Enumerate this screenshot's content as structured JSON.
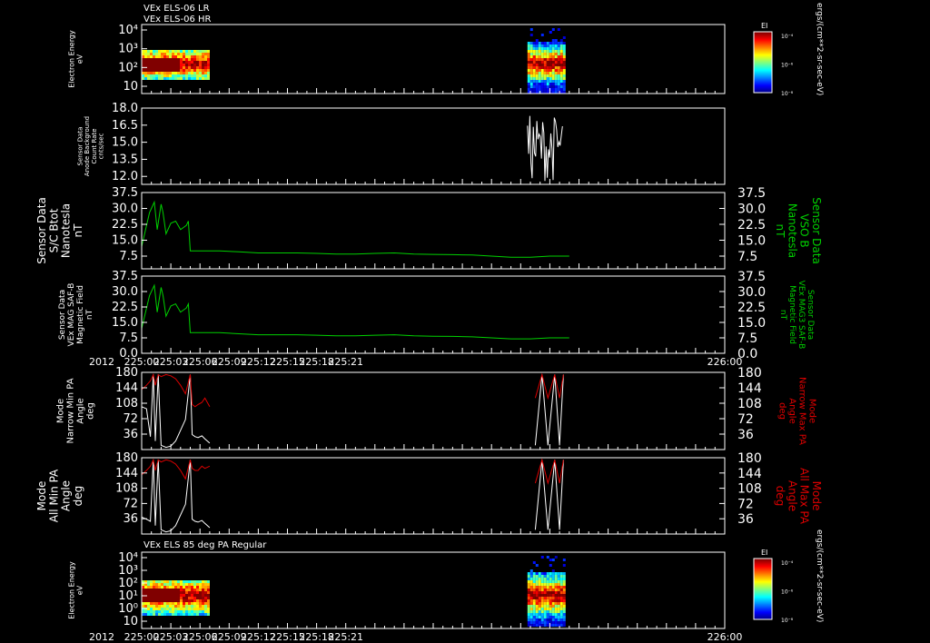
{
  "header_lines": [
    "VEx ELS-06 LR",
    "VEx ELS-06 HR"
  ],
  "year_label": "2012",
  "colors": {
    "white": "#ffffff",
    "green": "#00d000",
    "red": "#dd0000"
  },
  "colorbars": [
    {
      "title": "EI",
      "ticks": [
        "10⁻⁴",
        "10⁻⁶",
        "10⁻⁸"
      ],
      "unit": "ergs/(cm**2-sr-sec-eV)"
    },
    {
      "title": "EI",
      "ticks": [
        "10⁻⁴",
        "10⁻⁶",
        "10⁻⁸"
      ],
      "unit": "ergs/(cm**2-sr-sec-eV)"
    }
  ],
  "panel7_title": "VEx ELS 85 deg PA Regular",
  "chart_data": [
    {
      "type": "heatmap",
      "ylabel": [
        "Electron Energy",
        "eV"
      ],
      "yscale": "log",
      "yticks": [
        "10⁴",
        "10³",
        "10²",
        "10"
      ],
      "x_range": [
        "225:00",
        "226:00"
      ],
      "data_intervals_min": [
        [
          0.0,
          7.0
        ],
        [
          39.7,
          43.4
        ]
      ]
    },
    {
      "type": "line",
      "ylabel": [
        "Sensor Data",
        "Anode Background",
        "Count Rate",
        "cnts/sec"
      ],
      "yticks": [
        "18.0",
        "16.5",
        "15.0",
        "13.5",
        "12.0"
      ],
      "ylim": [
        11.3,
        18.0
      ],
      "series": [
        {
          "color": "white",
          "x_min_range": [
            39.7,
            43.4
          ],
          "y_range": [
            11.6,
            17.4
          ]
        }
      ]
    },
    {
      "type": "line",
      "ylabel": [
        "Sensor Data",
        "S/C Btot",
        "Nanotesla",
        "nT"
      ],
      "ylabel_right": [
        "Sensor Data",
        "VSO B",
        "Nanotesla",
        "nT"
      ],
      "yticks": [
        "37.5",
        "30.0",
        "22.5",
        "15.0",
        "7.5"
      ],
      "ylim": [
        1.5,
        37.5
      ],
      "series": [
        {
          "color": "green",
          "x": [
            0,
            0.8,
            1.3,
            1.6,
            2.0,
            2.2,
            2.5,
            3.0,
            3.5,
            4.0,
            4.3,
            4.6,
            4.8,
            5.0,
            6,
            8,
            10,
            12,
            14,
            16,
            18,
            20,
            22,
            24,
            26,
            28,
            30,
            32,
            34,
            36,
            38,
            40,
            42,
            44
          ],
          "y": [
            12,
            28,
            33,
            20,
            32,
            28,
            18,
            23,
            24,
            20,
            21,
            22,
            24,
            10,
            10,
            10,
            9.5,
            9,
            9,
            9,
            8.8,
            8.5,
            8.5,
            8.8,
            9,
            8.5,
            8.3,
            8.2,
            8,
            7.5,
            7,
            7,
            7.5,
            7.5
          ]
        }
      ]
    },
    {
      "type": "line",
      "ylabel": [
        "Sensor Data",
        "VEx MAG SAF-B",
        "Magnetic Field",
        "nT"
      ],
      "ylabel_right": [
        "Sensor Data",
        "VEx MAG3 SAF-B",
        "Magnetic Field",
        "nT"
      ],
      "yticks": [
        "37.5",
        "30.0",
        "22.5",
        "15.0",
        "7.5",
        "0.0"
      ],
      "ylim": [
        0,
        37.5
      ],
      "series": [
        {
          "color": "green",
          "x": [
            0,
            0.8,
            1.3,
            1.6,
            2.0,
            2.2,
            2.5,
            3.0,
            3.5,
            4.0,
            4.3,
            4.6,
            4.8,
            5.0,
            6,
            8,
            10,
            12,
            14,
            16,
            18,
            20,
            22,
            24,
            26,
            28,
            30,
            32,
            34,
            36,
            38,
            40,
            42,
            44
          ],
          "y": [
            12,
            28,
            33,
            20,
            32,
            28,
            18,
            23,
            24,
            20,
            21,
            22,
            24,
            10,
            10,
            10,
            9.5,
            9,
            9,
            9,
            8.8,
            8.5,
            8.5,
            8.8,
            9,
            8.5,
            8.3,
            8.2,
            8,
            7.5,
            7,
            7,
            7.5,
            7.5
          ]
        }
      ],
      "xtick_labels": [
        "225:00",
        "225:03",
        "225:06",
        "225:09",
        "225:12",
        "225:15",
        "225:18",
        "225:21",
        "226:00"
      ]
    },
    {
      "type": "line",
      "ylabel": [
        "Mode",
        "Narrow Min PA",
        "Angle",
        "deg"
      ],
      "ylabel_right": [
        "Mode",
        "Narrow Max PA",
        "Angle",
        "deg"
      ],
      "yticks": [
        "180",
        "144",
        "108",
        "72",
        "36"
      ],
      "ylim": [
        0,
        180
      ],
      "series": [
        {
          "name": "min",
          "color": "white",
          "x": [
            0,
            0.5,
            0.9,
            1.2,
            1.4,
            1.7,
            2.0,
            2.5,
            3.0,
            3.5,
            4.0,
            4.5,
            5.0,
            5.2,
            5.5,
            5.8,
            6.2,
            6.5,
            7.0
          ],
          "y": [
            100,
            95,
            30,
            175,
            20,
            175,
            10,
            5,
            8,
            20,
            45,
            70,
            175,
            35,
            30,
            28,
            32,
            25,
            15
          ]
        },
        {
          "name": "max",
          "color": "red",
          "x": [
            0,
            0.5,
            0.9,
            1.2,
            1.4,
            1.7,
            2.0,
            2.5,
            3.0,
            3.5,
            4.0,
            4.5,
            5.0,
            5.2,
            5.5,
            5.8,
            6.2,
            6.5,
            7.0
          ],
          "y": [
            140,
            150,
            160,
            175,
            150,
            175,
            170,
            175,
            172,
            165,
            150,
            130,
            175,
            105,
            100,
            105,
            110,
            120,
            100
          ]
        }
      ]
    },
    {
      "type": "line",
      "ylabel": [
        "Mode",
        "All Min PA",
        "Angle",
        "deg"
      ],
      "ylabel_right": [
        "Mode",
        "All Max PA",
        "Angle",
        "deg"
      ],
      "yticks": [
        "180",
        "144",
        "108",
        "72",
        "36"
      ],
      "ylim": [
        0,
        180
      ],
      "series": [
        {
          "name": "min",
          "color": "white",
          "x": [
            0,
            0.5,
            0.9,
            1.2,
            1.4,
            1.7,
            2.0,
            2.5,
            3.0,
            3.5,
            4.0,
            4.5,
            5.0,
            5.2,
            5.5,
            5.8,
            6.2,
            6.5,
            7.0
          ],
          "y": [
            40,
            35,
            30,
            175,
            20,
            175,
            10,
            5,
            8,
            20,
            45,
            70,
            175,
            35,
            30,
            28,
            32,
            25,
            15
          ]
        },
        {
          "name": "max",
          "color": "red",
          "x": [
            0,
            0.5,
            0.9,
            1.2,
            1.4,
            1.7,
            2.0,
            2.5,
            3.0,
            3.5,
            4.0,
            4.5,
            5.0,
            5.2,
            5.5,
            5.8,
            6.2,
            6.5,
            7.0
          ],
          "y": [
            140,
            150,
            160,
            175,
            150,
            175,
            170,
            175,
            172,
            165,
            150,
            130,
            175,
            155,
            150,
            150,
            160,
            155,
            160
          ]
        }
      ]
    },
    {
      "type": "heatmap",
      "ylabel": [
        "Electron Energy",
        "eV"
      ],
      "yscale": "log",
      "yticks": [
        "10⁴",
        "10³",
        "10²",
        "10¹",
        "10⁰",
        "10"
      ],
      "xtick_labels": [
        "225:00",
        "225:03",
        "225:06",
        "225:09",
        "225:12",
        "225:15",
        "225:18",
        "225:21",
        "226:00"
      ],
      "data_intervals_min": [
        [
          0.0,
          7.0
        ],
        [
          39.7,
          43.4
        ]
      ]
    }
  ]
}
